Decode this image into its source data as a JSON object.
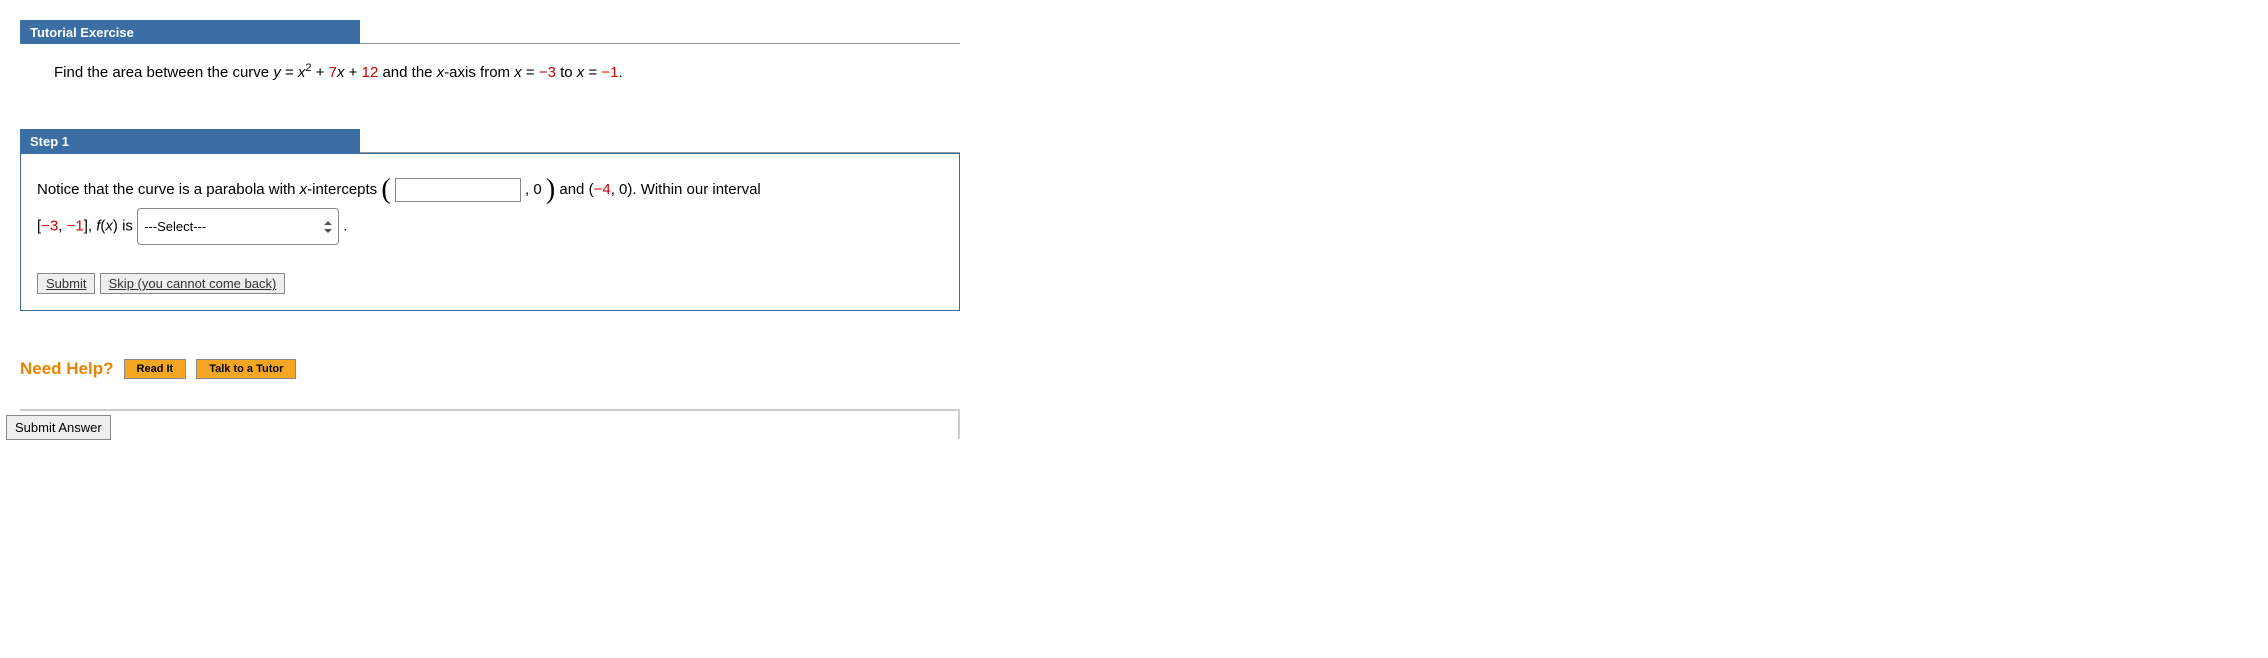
{
  "tutorial": {
    "header": "Tutorial Exercise",
    "prompt_prefix": "Find the area between the curve ",
    "y_eq": "y",
    "equals": " = ",
    "x_var": "x",
    "sq": "2",
    "plus": " + ",
    "coef7": "7",
    "const12": "12",
    "and_xaxis_from": " and the ",
    "xaxis": "x-axis",
    "from": " from ",
    "x_eq1": "x",
    "val1": "−3",
    "to": " to ",
    "x_eq2": "x",
    "val2": "−1",
    "period": "."
  },
  "step1": {
    "header": "Step 1",
    "line1a": "Notice that the curve is a parabola with ",
    "xintercepts": "x-intercepts",
    "open": "(",
    "comma_zero": ", 0",
    "close": ")",
    "and": " and (",
    "neg4": "−4",
    "zero_close": ", 0). Within our interval",
    "interval_open": "[",
    "neg3": "−3",
    "comma": ", ",
    "neg1": "−1",
    "interval_close": "], ",
    "fx": "f",
    "fx_of": "(",
    "fx_x": "x",
    "fx_close": ")",
    "is": " is ",
    "select_placeholder": "---Select---",
    "dot": " .",
    "submit": "Submit",
    "skip": "Skip (you cannot come back)"
  },
  "help": {
    "label": "Need Help?",
    "read": "Read It",
    "tutor": "Talk to a Tutor"
  },
  "footer": {
    "submit": "Submit Answer"
  }
}
